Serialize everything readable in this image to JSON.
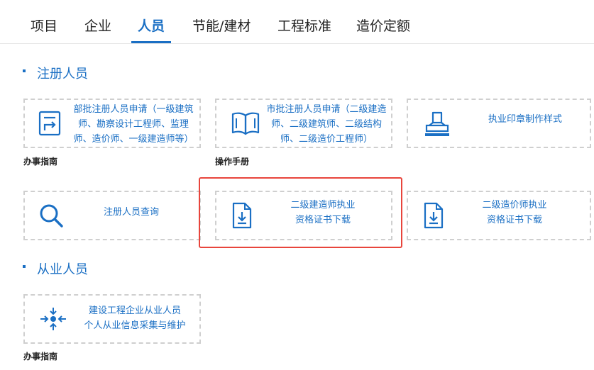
{
  "tabs": [
    {
      "label": "项目"
    },
    {
      "label": "企业"
    },
    {
      "label": "人员"
    },
    {
      "label": "节能/建材"
    },
    {
      "label": "工程标准"
    },
    {
      "label": "造价定额"
    }
  ],
  "active_tab": "人员",
  "sections": {
    "registered": {
      "title": "注册人员"
    },
    "practitioners": {
      "title": "从业人员"
    }
  },
  "cards": {
    "ministry_apply": {
      "line1": "部批注册人员申请（一级建筑",
      "line2": "师、勘察设计工程师、监理",
      "line3": "师、造价师、一级建造师等）",
      "icon": "document-export-icon"
    },
    "city_apply": {
      "line1": "市批注册人员申请（二级建造",
      "line2": "师、二级建筑师、二级结构",
      "line3": "师、二级造价工程师）",
      "icon": "open-book-icon"
    },
    "seal": {
      "line1": "执业印章制作样式",
      "icon": "stamp-icon"
    },
    "query": {
      "line1": "注册人员查询",
      "icon": "search-icon"
    },
    "constructor_cert": {
      "line1": "二级建造师执业",
      "line2": "资格证书下载",
      "icon": "file-download-icon"
    },
    "cost_cert": {
      "line1": "二级造价师执业",
      "line2": "资格证书下载",
      "icon": "file-download-icon"
    },
    "practitioner_info": {
      "line1": "建设工程企业从业人员",
      "line2": "个人从业信息采集与维护",
      "icon": "converge-arrows-icon"
    }
  },
  "sublinks": {
    "guide1": "办事指南",
    "manual": "操作手册",
    "guide2": "办事指南"
  },
  "colors": {
    "accent": "#1a6fc4",
    "highlight": "#e8453c",
    "border": "#cfcfcf"
  }
}
